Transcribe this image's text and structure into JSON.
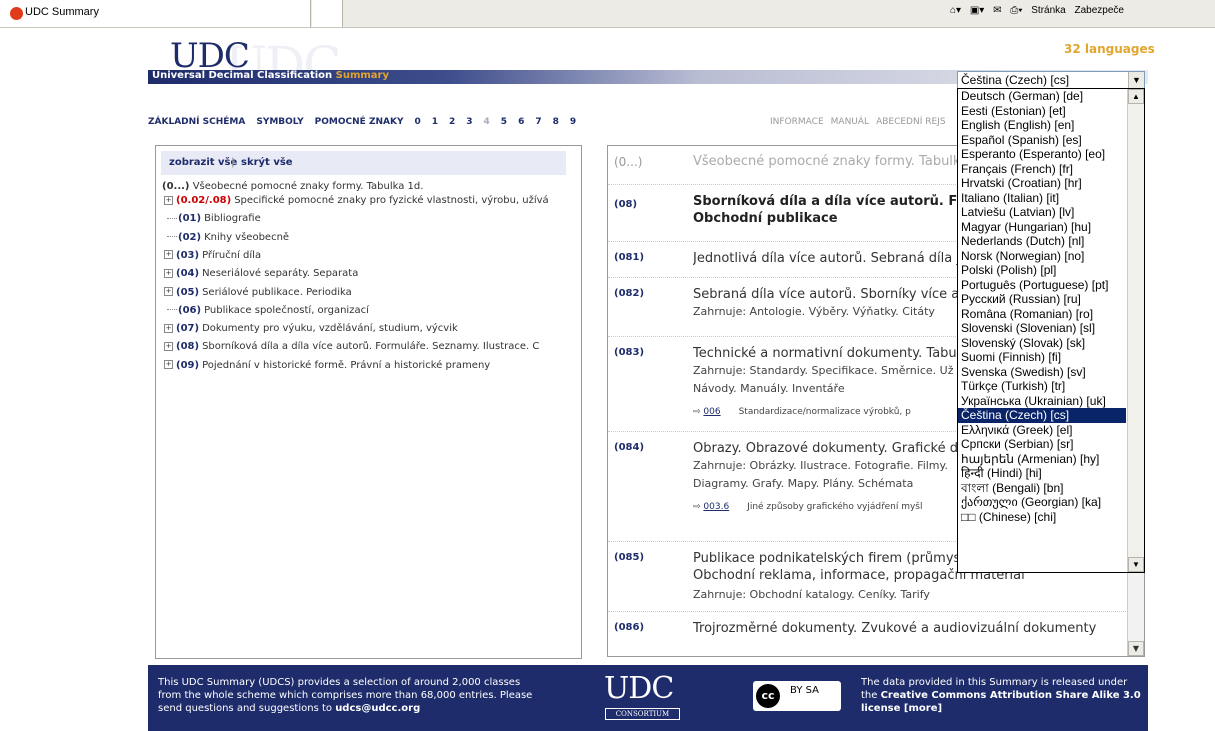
{
  "browser": {
    "tab_title": "UDC Summary",
    "toolbar_items": [
      "Stránka",
      "Zabezpeče"
    ]
  },
  "header": {
    "logo": "UDC",
    "subtitle": "Universal Decimal Classification",
    "subtitle_accent": "Summary",
    "languages_count": "32 languages"
  },
  "nav": {
    "left": [
      "ZÁKLADNÍ SCHÉMA",
      "SYMBOLY",
      "POMOCNÉ ZNAKY",
      "0",
      "1",
      "2",
      "3",
      "4",
      "5",
      "6",
      "7",
      "8",
      "9"
    ],
    "right": [
      "INFORMACE",
      "MANUÁL",
      "ABECEDNÍ REJS"
    ]
  },
  "left_panel": {
    "show_all": "zobrazit vše",
    "hide_all": "skrýt vše",
    "root_code": "(0...)",
    "root_text": "Všeobecné pomocné znaky formy. Tabulka 1d.",
    "items": [
      {
        "code": "(0.02/.08)",
        "text": "Specifické pomocné znaky pro fyzické vlastnosti, výrobu, užívá",
        "expandable": true,
        "red": true
      },
      {
        "code": "(01)",
        "text": "Bibliografie",
        "expandable": false,
        "red": false
      },
      {
        "code": "(02)",
        "text": "Knihy všeobecně",
        "expandable": false,
        "red": false
      },
      {
        "code": "(03)",
        "text": "Příruční díla",
        "expandable": true,
        "red": false
      },
      {
        "code": "(04)",
        "text": "Neseriálové separáty. Separata",
        "expandable": true,
        "red": false
      },
      {
        "code": "(05)",
        "text": "Seriálové publikace. Periodika",
        "expandable": true,
        "red": false
      },
      {
        "code": "(06)",
        "text": "Publikace společností, organizací",
        "expandable": false,
        "red": false
      },
      {
        "code": "(07)",
        "text": "Dokumenty pro výuku, vzdělávání, studium, výcvik",
        "expandable": true,
        "red": false
      },
      {
        "code": "(08)",
        "text": "Sborníková díla a díla více autorů. Formuláře. Seznamy. Ilustrace. C",
        "expandable": true,
        "red": false
      },
      {
        "code": "(09)",
        "text": "Pojednání v historické formě. Právní a historické prameny",
        "expandable": true,
        "red": false
      }
    ]
  },
  "right_panel": {
    "rows": [
      {
        "code": "(0...)",
        "title": "Všeobecné pomocné znaky formy. Tabulka",
        "title2": "",
        "sub1": "",
        "sub2": "",
        "ref_link": "",
        "ref_text": ""
      },
      {
        "code": "(08)",
        "title": "Sborníková díla a díla více autorů. Formulář",
        "title2": "Obchodní publikace",
        "sub1": "",
        "sub2": "",
        "ref_link": "",
        "ref_text": ""
      },
      {
        "code": "(081)",
        "title": "Jednotlivá díla více autorů. Sebraná díla jed",
        "title2": "",
        "sub1": "",
        "sub2": "",
        "ref_link": "",
        "ref_text": ""
      },
      {
        "code": "(082)",
        "title": "Sebraná díla více autorů. Sborníky více auto",
        "title2": "",
        "sub1": "Zahrnuje: Antologie. Výběry. Výňatky. Citáty",
        "sub2": "",
        "ref_link": "",
        "ref_text": ""
      },
      {
        "code": "(083)",
        "title": "Technické a normativní dokumenty. Tabulk",
        "title2": "",
        "sub1": "Zahrnuje: Standardy. Specifikace. Směrnice. Už",
        "sub2": "Návody. Manuály. Inventáře",
        "ref_link": "006",
        "ref_text": "Standardizace/normalizace výrobků, p"
      },
      {
        "code": "(084)",
        "title": "Obrazy. Obrazové dokumenty. Grafické dok",
        "title2": "",
        "sub1": "Zahrnuje: Obrázky. Ilustrace. Fotografie. Filmy.",
        "sub2": "Diagramy. Grafy. Mapy. Plány. Schémata",
        "ref_link": "003.6",
        "ref_text": "Jiné způsoby grafického vyjádření myšl"
      },
      {
        "code": "(085)",
        "title": "Publikace podnikatelských firem (průmyslo",
        "title2": "Obchodní reklama, informace, propagační materiál",
        "sub1": "Zahrnuje: Obchodní katalogy. Ceníky. Tarify",
        "sub2": "",
        "ref_link": "",
        "ref_text": ""
      },
      {
        "code": "(086)",
        "title": "Trojrozměrné dokumenty. Zvukové a audiovizuální dokumenty",
        "title2": "",
        "sub1": "",
        "sub2": "",
        "ref_link": "",
        "ref_text": ""
      }
    ]
  },
  "language_select": {
    "value": "Čeština (Czech) [cs]",
    "options": [
      "Deutsch (German) [de]",
      "Eesti (Estonian) [et]",
      "English (English) [en]",
      "Español (Spanish) [es]",
      "Esperanto (Esperanto) [eo]",
      "Français (French) [fr]",
      "Hrvatski (Croatian) [hr]",
      "Italiano (Italian) [it]",
      "Latviešu (Latvian) [lv]",
      "Magyar (Hungarian) [hu]",
      "Nederlands (Dutch) [nl]",
      "Norsk (Norwegian) [no]",
      "Polski (Polish) [pl]",
      "Português (Portuguese) [pt]",
      "Русский (Russian) [ru]",
      "Româna (Romanian) [ro]",
      "Slovenski (Slovenian) [sl]",
      "Slovenský (Slovak) [sk]",
      "Suomi (Finnish) [fi]",
      "Svenska (Swedish) [sv]",
      "Türkçe (Turkish) [tr]",
      "Українська (Ukrainian) [uk]",
      "Čeština (Czech) [cs]",
      "Ελληνικά (Greek) [el]",
      "Српски (Serbian) [sr]",
      "հայերեն (Armenian) [hy]",
      "हिन्दी (Hindi) [hi]",
      "বাংলা (Bengali) [bn]",
      "ქართული (Georgian) [ka]",
      "□□ (Chinese) [chi]"
    ],
    "selected_index": 22
  },
  "footer": {
    "text_pre": "This UDC Summary (UDCS) provides a selection of around 2,000 classes from the whole scheme which comprises more than 68,000 entries. Please send questions and suggestions to ",
    "email": "udcs@udcc.org",
    "logo": "UDC",
    "consortium": "CONSORTIUM",
    "cc_label": "BY SA",
    "license_pre": "The data provided in this Summary is released under the ",
    "license_bold": "Creative Commons Attribution Share Alike 3.0 license [more]"
  },
  "colors": {
    "brand_navy": "#1e2c6b",
    "accent_gold": "#e2a62f",
    "select_highlight": "#0a246a"
  }
}
